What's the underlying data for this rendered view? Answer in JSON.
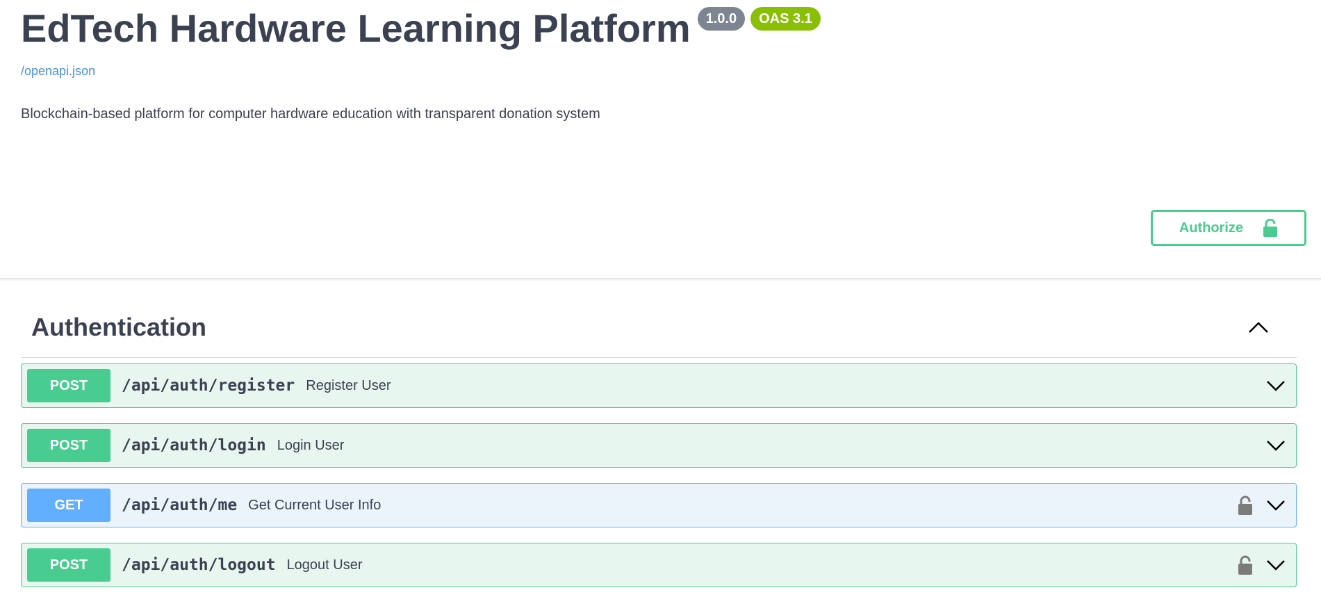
{
  "info": {
    "title": "EdTech Hardware Learning Platform",
    "version_badge": "1.0.0",
    "oas_badge": "OAS 3.1",
    "spec_link": "/openapi.json",
    "description": "Blockchain-based platform for computer hardware education with transparent donation system",
    "authorize_label": "Authorize"
  },
  "colors": {
    "post": "#49cc90",
    "get": "#61affe",
    "version_badge": "#7d8492",
    "oas_badge": "#89bf04",
    "text": "#3b4151",
    "link": "#4990e2"
  },
  "section": {
    "title": "Authentication",
    "expanded": true,
    "toggle_icon": "chevron-up-icon"
  },
  "operations": [
    {
      "method": "POST",
      "path": "/api/auth/register",
      "summary": "Register User",
      "locked": false
    },
    {
      "method": "POST",
      "path": "/api/auth/login",
      "summary": "Login User",
      "locked": false
    },
    {
      "method": "GET",
      "path": "/api/auth/me",
      "summary": "Get Current User Info",
      "locked": true
    },
    {
      "method": "POST",
      "path": "/api/auth/logout",
      "summary": "Logout User",
      "locked": true
    }
  ]
}
